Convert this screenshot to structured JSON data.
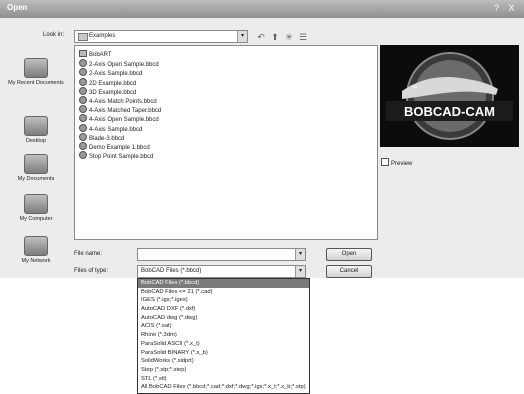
{
  "window": {
    "title": "Open",
    "help_glyph": "?",
    "close_glyph": "X"
  },
  "lookin": {
    "label": "Look in:",
    "value": "Examples"
  },
  "toolbar": [
    {
      "name": "back-icon",
      "glyph": "↶"
    },
    {
      "name": "up-folder-icon",
      "glyph": "⬆"
    },
    {
      "name": "new-folder-icon",
      "glyph": "✳"
    },
    {
      "name": "views-menu-icon",
      "glyph": "☰"
    }
  ],
  "places": [
    {
      "label": "My Recent Documents"
    },
    {
      "label": "Desktop"
    },
    {
      "label": "My Documents"
    },
    {
      "label": "My Computer"
    },
    {
      "label": "My Network"
    }
  ],
  "files": [
    {
      "name": "BobART",
      "type": "folder"
    },
    {
      "name": "2-Axis Open Sample.bbcd",
      "type": "file"
    },
    {
      "name": "2-Axis Sample.bbcd",
      "type": "file"
    },
    {
      "name": "2D Example.bbcd",
      "type": "file"
    },
    {
      "name": "3D Example.bbcd",
      "type": "file"
    },
    {
      "name": "4-Axis Match Points.bbcd",
      "type": "file"
    },
    {
      "name": "4-Axis Matched Taper.bbcd",
      "type": "file"
    },
    {
      "name": "4-Axis Open Sample.bbcd",
      "type": "file"
    },
    {
      "name": "4-Axis Sample.bbcd",
      "type": "file"
    },
    {
      "name": "Blade-3.bbcd",
      "type": "file"
    },
    {
      "name": "Demo Example 1.bbcd",
      "type": "file"
    },
    {
      "name": "Stop Point Sample.bbcd",
      "type": "file"
    }
  ],
  "preview": {
    "logo_text": "BOBCAD-CAM",
    "checkbox_label": "Preview"
  },
  "filename": {
    "label": "File name:",
    "value": ""
  },
  "filetype": {
    "label": "Files of type:",
    "value": "BobCAD Files (*.bbcd)"
  },
  "buttons": {
    "open": "Open",
    "cancel": "Cancel"
  },
  "filetype_options": [
    {
      "label": "BobCAD Files (*.bbcd)",
      "selected": true
    },
    {
      "label": "BobCAD Files <= 21 (*.cad)",
      "selected": false
    },
    {
      "label": "IGES (*.igs;*.iges)",
      "selected": false
    },
    {
      "label": "AutoCAD DXF (*.dxf)",
      "selected": false
    },
    {
      "label": "AutoCAD dwg (*.dwg)",
      "selected": false
    },
    {
      "label": "ACIS (*.sat)",
      "selected": false
    },
    {
      "label": "Rhino (*.3dm)",
      "selected": false
    },
    {
      "label": "ParaSolid ASCII (*.x_t)",
      "selected": false
    },
    {
      "label": "ParaSolid BINARY (*.x_b)",
      "selected": false
    },
    {
      "label": "SolidWorks (*.sldprt)",
      "selected": false
    },
    {
      "label": "Step (*.stp;*.step)",
      "selected": false
    },
    {
      "label": "STL (*.stl)",
      "selected": false
    },
    {
      "label": "All BobCAD Files (*.bbcd;*.cad;*.dxf;*.dwg;*.igs;*.x_t;*.x_b;*.stp)",
      "selected": false
    }
  ]
}
